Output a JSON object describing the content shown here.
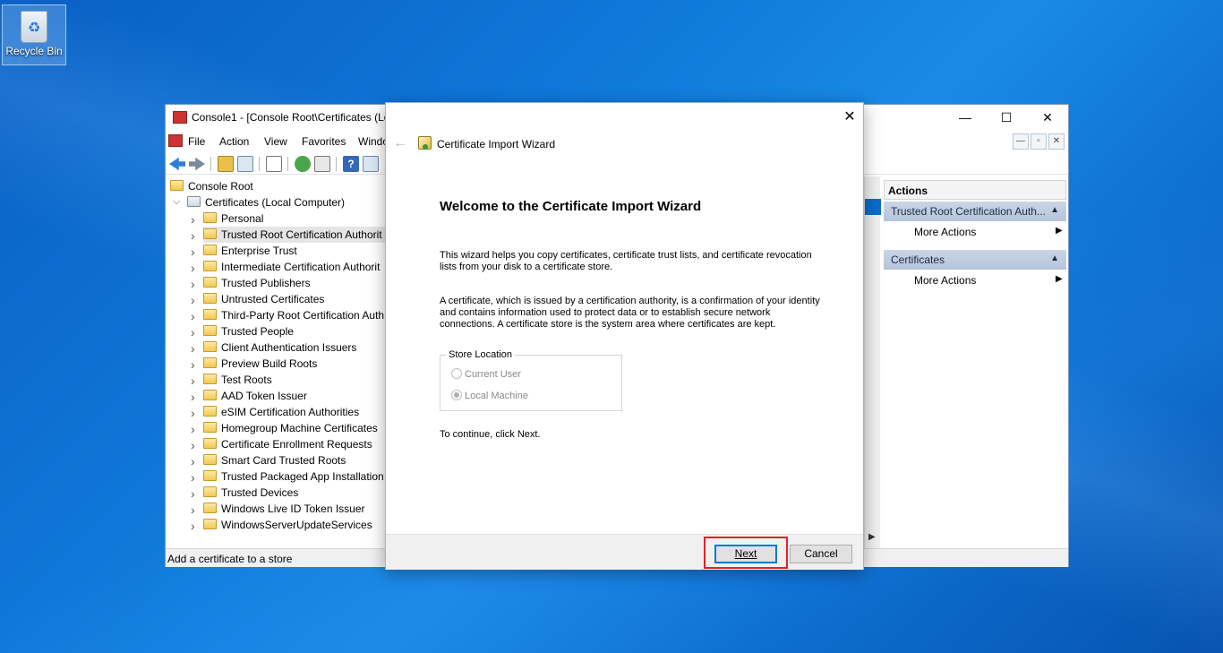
{
  "desktop": {
    "recycle_bin_label": "Recycle Bin"
  },
  "mmc": {
    "title": "Console1 - [Console Root\\Certificates (Lo",
    "window_buttons": {
      "minimize": "—",
      "maximize": "☐",
      "close": "✕"
    },
    "menu": [
      "File",
      "Action",
      "View",
      "Favorites",
      "Windo"
    ],
    "mdi_buttons": [
      "—",
      "▫",
      "✕"
    ],
    "tree": {
      "root": "Console Root",
      "certificates": "Certificates (Local Computer)",
      "items": [
        "Personal",
        "Trusted Root Certification Authorit",
        "Enterprise Trust",
        "Intermediate Certification Authorit",
        "Trusted Publishers",
        "Untrusted Certificates",
        "Third-Party Root Certification Auth",
        "Trusted People",
        "Client Authentication Issuers",
        "Preview Build Roots",
        "Test Roots",
        "AAD Token Issuer",
        "eSIM Certification Authorities",
        "Homegroup Machine Certificates",
        "Certificate Enrollment Requests",
        "Smart Card Trusted Roots",
        "Trusted Packaged App Installation A",
        "Trusted Devices",
        "Windows Live ID Token Issuer",
        "WindowsServerUpdateServices"
      ],
      "selected_index": 1
    },
    "status_text": "Add a certificate to a store",
    "actions": {
      "header": "Actions",
      "group1": "Trusted Root Certification Auth...",
      "group1_item": "More Actions",
      "group2": "Certificates",
      "group2_item": "More Actions"
    }
  },
  "wizard": {
    "window_title": "Certificate Import Wizard",
    "close_glyph": "✕",
    "back_glyph": "←",
    "heading": "Welcome to the Certificate Import Wizard",
    "para1": "This wizard helps you copy certificates, certificate trust lists, and certificate revocation lists from your disk to a certificate store.",
    "para2": "A certificate, which is issued by a certification authority, is a confirmation of your identity and contains information used to protect data or to establish secure network connections. A certificate store is the system area where certificates are kept.",
    "store_location_label": "Store Location",
    "options": [
      "Current User",
      "Local Machine"
    ],
    "selected_option": "Local Machine",
    "continue_text": "To continue, click Next.",
    "next_label": "Next",
    "cancel_label": "Cancel"
  },
  "colors": {
    "accent": "#0078d7",
    "highlight_box": "#e0222a",
    "desktop": "#0f78d8"
  }
}
